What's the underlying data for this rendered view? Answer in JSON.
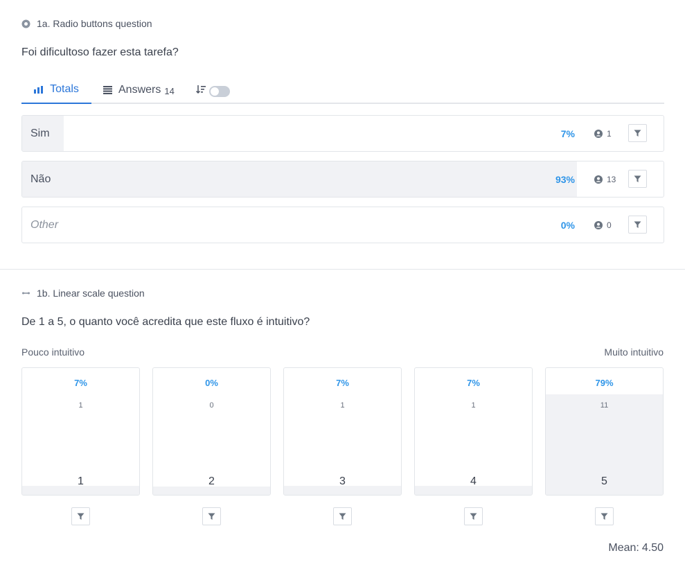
{
  "q1a": {
    "header": "1a. Radio buttons question",
    "question": "Foi dificultoso fazer esta tarefa?",
    "tabs": {
      "totals_label": "Totals",
      "answers_label": "Answers",
      "answers_count": "14"
    },
    "options": [
      {
        "label": "Sim",
        "percent": "7%",
        "count": "1",
        "share": 0.07,
        "italic": false
      },
      {
        "label": "Não",
        "percent": "93%",
        "count": "13",
        "share": 0.93,
        "italic": false
      },
      {
        "label": "Other",
        "percent": "0%",
        "count": "0",
        "share": 0,
        "italic": true
      }
    ]
  },
  "q1b": {
    "header": "1b. Linear scale question",
    "question": "De 1 a 5, o quanto você acredita que este fluxo é intuitivo?",
    "low_label": "Pouco intuitivo",
    "high_label": "Muito intuitivo",
    "scale": [
      {
        "value": "1",
        "percent": "7%",
        "count": "1",
        "share": 0.07
      },
      {
        "value": "2",
        "percent": "0%",
        "count": "0",
        "share": 0
      },
      {
        "value": "3",
        "percent": "7%",
        "count": "1",
        "share": 0.07
      },
      {
        "value": "4",
        "percent": "7%",
        "count": "1",
        "share": 0.07
      },
      {
        "value": "5",
        "percent": "79%",
        "count": "11",
        "share": 0.79
      }
    ],
    "mean_label": "Mean:",
    "mean_value": "4.50"
  },
  "colors": {
    "accent": "#2b76d9",
    "percent": "#2f95e8",
    "fill": "#f1f2f5",
    "border": "#e2e5e9"
  }
}
